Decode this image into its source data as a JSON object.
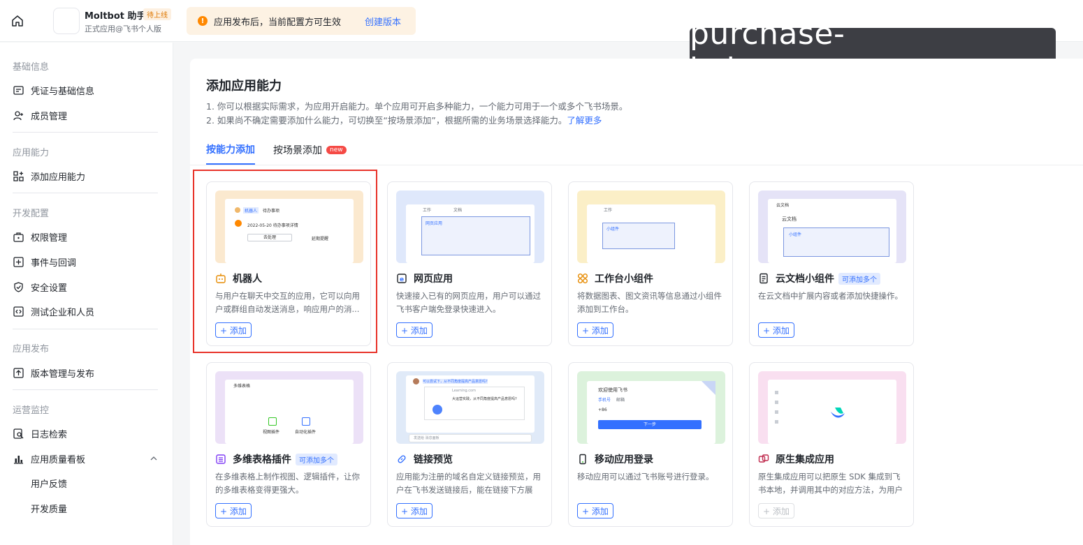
{
  "header": {
    "app_name": "Moltbot 助手",
    "app_badge": "待上线",
    "app_sub": "正式应用@飞书个人版",
    "notice_text": "应用发布后，当前配置方可生效",
    "notice_link": "创建版本",
    "watermark": "purchase-kaiyun.com.cn"
  },
  "sidebar": {
    "groups": [
      "基础信息",
      "应用能力",
      "开发配置",
      "应用发布",
      "运营监控"
    ],
    "items": {
      "credentials": "凭证与基础信息",
      "members": "成员管理",
      "add_capability": "添加应用能力",
      "permissions": "权限管理",
      "events": "事件与回调",
      "security": "安全设置",
      "test_org": "测试企业和人员",
      "versions": "版本管理与发布",
      "logs": "日志检索",
      "quality": "应用质量看板",
      "feedback": "用户反馈",
      "dev_quality": "开发质量"
    }
  },
  "main": {
    "title": "添加应用能力",
    "desc1": "1. 你可以根据实际需求，为应用开启能力。单个应用可开启多种能力，一个能力可用于一个或多个飞书场景。",
    "desc2": "2. 如果尚不确定需要添加什么能力，可切换至“按场景添加”，根据所需的业务场景选择能力。",
    "learn_more": "了解更多",
    "tabs": [
      {
        "label": "按能力添加",
        "active": true
      },
      {
        "label": "按场景添加",
        "badge": "new"
      }
    ]
  },
  "add_label": "+ 添加",
  "cards": [
    {
      "title": "机器人",
      "desc": "与用户在聊天中交互的应用，它可以向用户或群组自动发送消息，响应用户的消...",
      "icon": "robot-icon",
      "preview_bg": "#fbe9cf",
      "preview": {
        "name": "机器人",
        "tag": "待办事项",
        "date": "2022-05-20 待办事项详情",
        "btn1": "去处理",
        "btn2": "延期提醒"
      }
    },
    {
      "title": "网页应用",
      "desc": "快速接入已有的网页应用，用户可以通过飞书客户端免登录快速进入。",
      "icon": "web-app-icon",
      "preview_bg": "#dfe8fb",
      "preview": {
        "tab1": "工作",
        "tab2": "文档",
        "label": "网页应用"
      }
    },
    {
      "title": "工作台小组件",
      "desc": "将数据图表、图文资讯等信息通过小组件添加到工作台。",
      "icon": "widget-icon",
      "preview_bg": "#fbefc7",
      "preview": {
        "tab": "工作",
        "label": "小组件"
      }
    },
    {
      "title": "云文档小组件",
      "tag": "可添加多个",
      "desc": "在云文档中扩展内容或者添加快捷操作。",
      "icon": "doc-widget-icon",
      "preview_bg": "#e5e3f7",
      "preview": {
        "title": "云文档",
        "sub": "云文档",
        "label": "小组件"
      }
    },
    {
      "title": "多维表格插件",
      "tag": "可添加多个",
      "desc": "在多维表格上制作视图、逻辑插件，让你的多维表格变得更强大。",
      "icon": "bitable-icon",
      "preview_bg": "#ece1f7",
      "preview": {
        "title": "多维表格",
        "p1": "视图插件",
        "p2": "自动化插件"
      }
    },
    {
      "title": "链接预览",
      "desc": "应用能为注册的域名自定义链接预览，用户在飞书发送链接后，能在链接下方展示...",
      "icon": "link-icon",
      "preview_bg": "#e0eaf8",
      "preview": {
        "msg": "可以尝试下，从不同角度提高产品意愿吗?",
        "url": "Learning.com",
        "card": "大运营实践，从不同角度提高产品意愿吗?",
        "input": "发送给 消息面板"
      }
    },
    {
      "title": "移动应用登录",
      "desc": "移动应用可以通过飞书账号进行登录。",
      "icon": "mobile-icon",
      "preview_bg": "#dcf2dc",
      "preview": {
        "title": "欢迎使用飞书",
        "t1": "手机号",
        "t2": "邮箱",
        "code": "+86",
        "btn": "下一步"
      }
    },
    {
      "title": "原生集成应用",
      "desc": "原生集成应用可以把原生 SDK 集成到飞书本地，并调用其中的对应方法，为用户提...",
      "icon": "native-app-icon",
      "preview_bg": "#f9dff0",
      "disabled": true,
      "preview": {}
    }
  ]
}
